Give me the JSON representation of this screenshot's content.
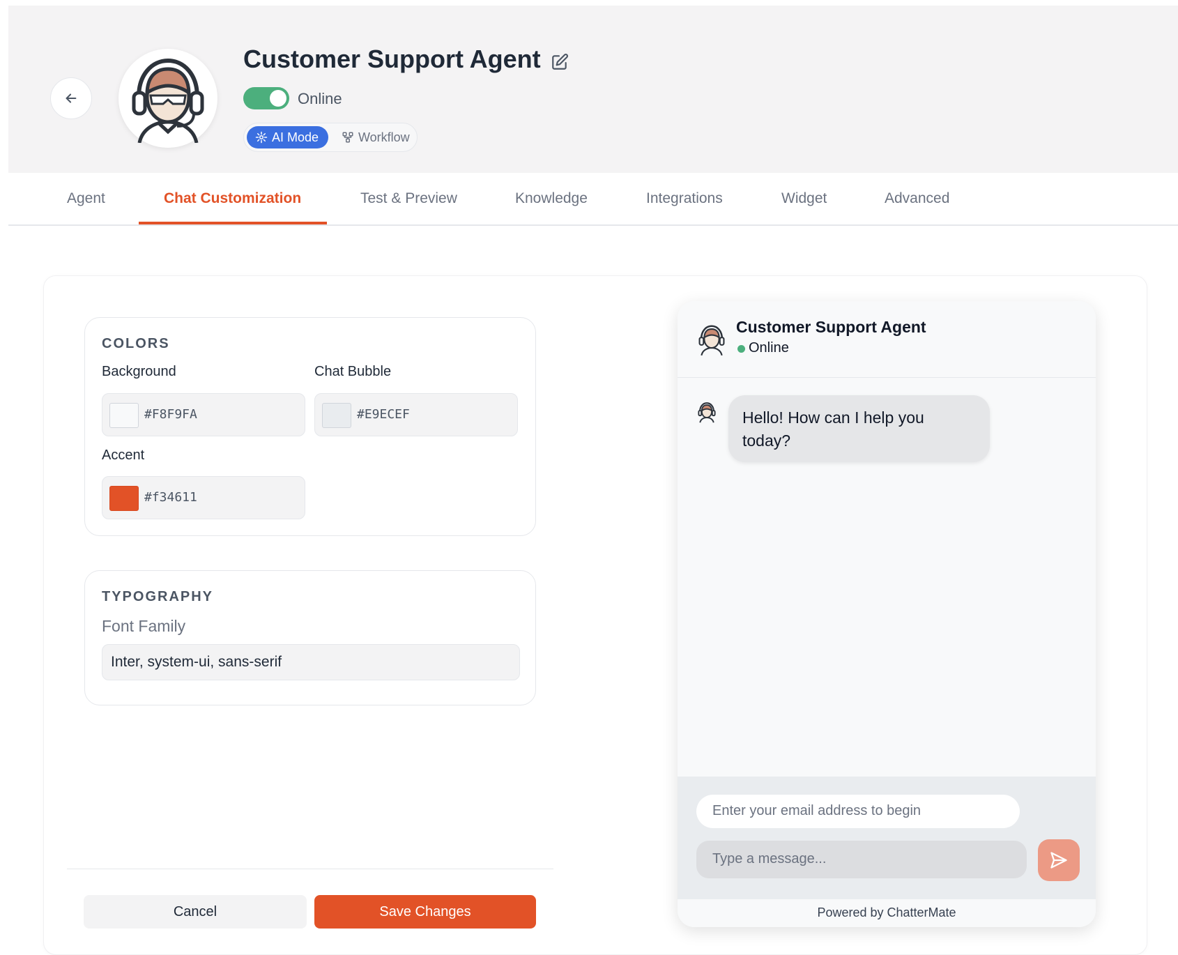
{
  "header": {
    "title": "Customer Support Agent",
    "status_label": "Online",
    "modes": {
      "ai_mode": "AI Mode",
      "workflow": "Workflow"
    }
  },
  "tabs": [
    {
      "label": "Agent"
    },
    {
      "label": "Chat Customization",
      "active": true
    },
    {
      "label": "Test & Preview"
    },
    {
      "label": "Knowledge"
    },
    {
      "label": "Integrations"
    },
    {
      "label": "Widget"
    },
    {
      "label": "Advanced"
    }
  ],
  "colors_section": {
    "title": "COLORS",
    "background": {
      "label": "Background",
      "value": "#F8F9FA"
    },
    "chat_bubble": {
      "label": "Chat Bubble",
      "value": "#E9ECEF"
    },
    "accent": {
      "label": "Accent",
      "value": "#f34611"
    }
  },
  "typography_section": {
    "title": "TYPOGRAPHY",
    "font_family_label": "Font Family",
    "font_family_value": "Inter, system-ui, sans-serif"
  },
  "actions": {
    "cancel": "Cancel",
    "save": "Save Changes"
  },
  "chat_preview": {
    "title": "Customer Support Agent",
    "status": "Online",
    "greeting": "Hello! How can I help you today?",
    "email_placeholder": "Enter your email address to begin",
    "message_placeholder": "Type a message...",
    "powered_by": "Powered by ChatterMate"
  },
  "theme": {
    "accent": "#e25227",
    "online_green": "#4caf7d",
    "ai_mode_blue": "#3b6fe0"
  },
  "icons": [
    "back-arrow-icon",
    "edit-icon",
    "sparkle-icon",
    "workflow-icon",
    "send-icon",
    "agent-avatar-icon"
  ]
}
